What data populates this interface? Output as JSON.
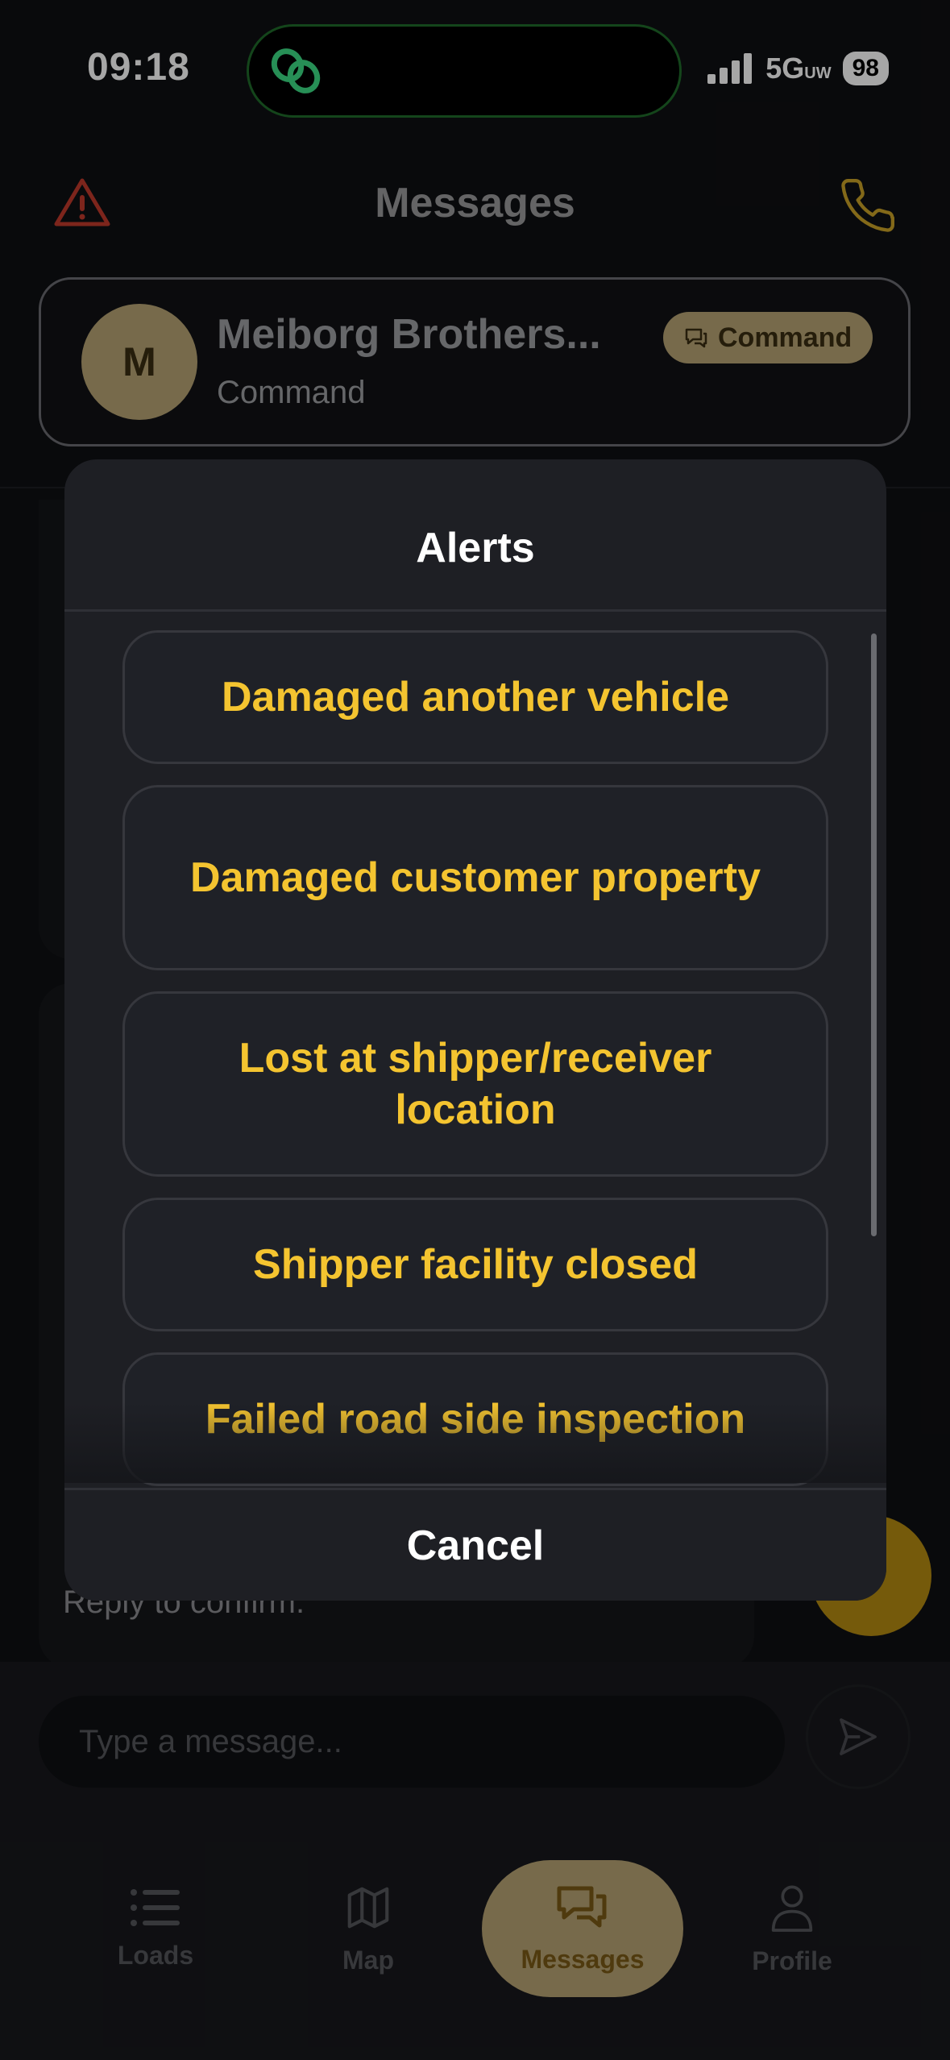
{
  "status_bar": {
    "time": "09:18",
    "network": "5G",
    "network_sup": "UW",
    "battery": "98"
  },
  "header": {
    "title": "Messages",
    "alert_icon": "alert-triangle-icon",
    "call_icon": "phone-icon"
  },
  "contact": {
    "avatar_letter": "M",
    "name": "Meiborg Brothers...",
    "subtitle": "Command",
    "badge": "Command"
  },
  "background": {
    "reply_text": "Reply to confirm."
  },
  "composer": {
    "placeholder": "Type a message..."
  },
  "tabs": [
    {
      "label": "Loads",
      "icon": "list-icon",
      "active": false
    },
    {
      "label": "Map",
      "icon": "map-icon",
      "active": false
    },
    {
      "label": "Messages",
      "icon": "chat-icon",
      "active": true
    },
    {
      "label": "Profile",
      "icon": "user-icon",
      "active": false
    }
  ],
  "alerts_sheet": {
    "title": "Alerts",
    "options": [
      "Damaged another vehicle",
      "Damaged customer property",
      "Lost at shipper/receiver location",
      "Shipper facility closed",
      "Failed road side inspection"
    ],
    "cancel": "Cancel"
  },
  "colors": {
    "accent": "#F4C430",
    "badge_bg": "#B7A474",
    "alert_red": "#C0392B",
    "phone_gold": "#C9A227"
  }
}
